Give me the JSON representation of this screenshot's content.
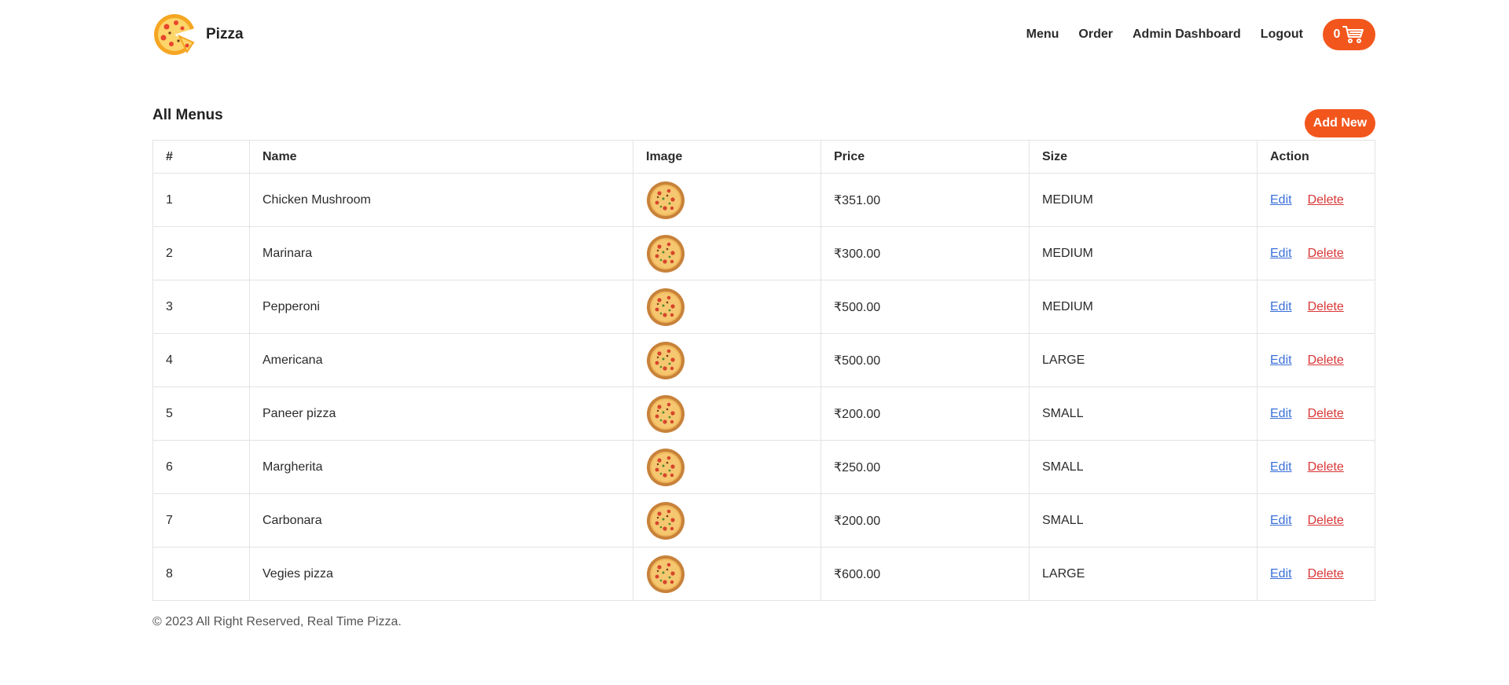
{
  "brand": {
    "name": "Pizza",
    "logo_icon": "pizza-logo-icon"
  },
  "nav": {
    "items": [
      {
        "label": "Menu"
      },
      {
        "label": "Order"
      },
      {
        "label": "Admin Dashboard"
      },
      {
        "label": "Logout"
      }
    ],
    "cart": {
      "count": "0",
      "icon": "cart-icon"
    }
  },
  "colors": {
    "accent": "#f2561d",
    "edit_link": "#3a6fd8",
    "delete_link": "#d93636",
    "border": "#e3e3e3"
  },
  "page": {
    "title": "All Menus",
    "add_button": "Add New"
  },
  "table": {
    "headers": [
      "#",
      "Name",
      "Image",
      "Price",
      "Size",
      "Action"
    ],
    "rows": [
      {
        "num": "1",
        "name": "Chicken Mushroom",
        "price": "₹351.00",
        "size": "MEDIUM",
        "edit": "Edit",
        "delete": "Delete"
      },
      {
        "num": "2",
        "name": "Marinara",
        "price": "₹300.00",
        "size": "MEDIUM",
        "edit": "Edit",
        "delete": "Delete"
      },
      {
        "num": "3",
        "name": "Pepperoni",
        "price": "₹500.00",
        "size": "MEDIUM",
        "edit": "Edit",
        "delete": "Delete"
      },
      {
        "num": "4",
        "name": "Americana",
        "price": "₹500.00",
        "size": "LARGE",
        "edit": "Edit",
        "delete": "Delete"
      },
      {
        "num": "5",
        "name": "Paneer pizza",
        "price": "₹200.00",
        "size": "SMALL",
        "edit": "Edit",
        "delete": "Delete"
      },
      {
        "num": "6",
        "name": "Margherita",
        "price": "₹250.00",
        "size": "SMALL",
        "edit": "Edit",
        "delete": "Delete"
      },
      {
        "num": "7",
        "name": "Carbonara",
        "price": "₹200.00",
        "size": "SMALL",
        "edit": "Edit",
        "delete": "Delete"
      },
      {
        "num": "8",
        "name": "Vegies pizza",
        "price": "₹600.00",
        "size": "LARGE",
        "edit": "Edit",
        "delete": "Delete"
      }
    ]
  },
  "footer": {
    "text": "© 2023 All Right Reserved, Real Time Pizza."
  }
}
